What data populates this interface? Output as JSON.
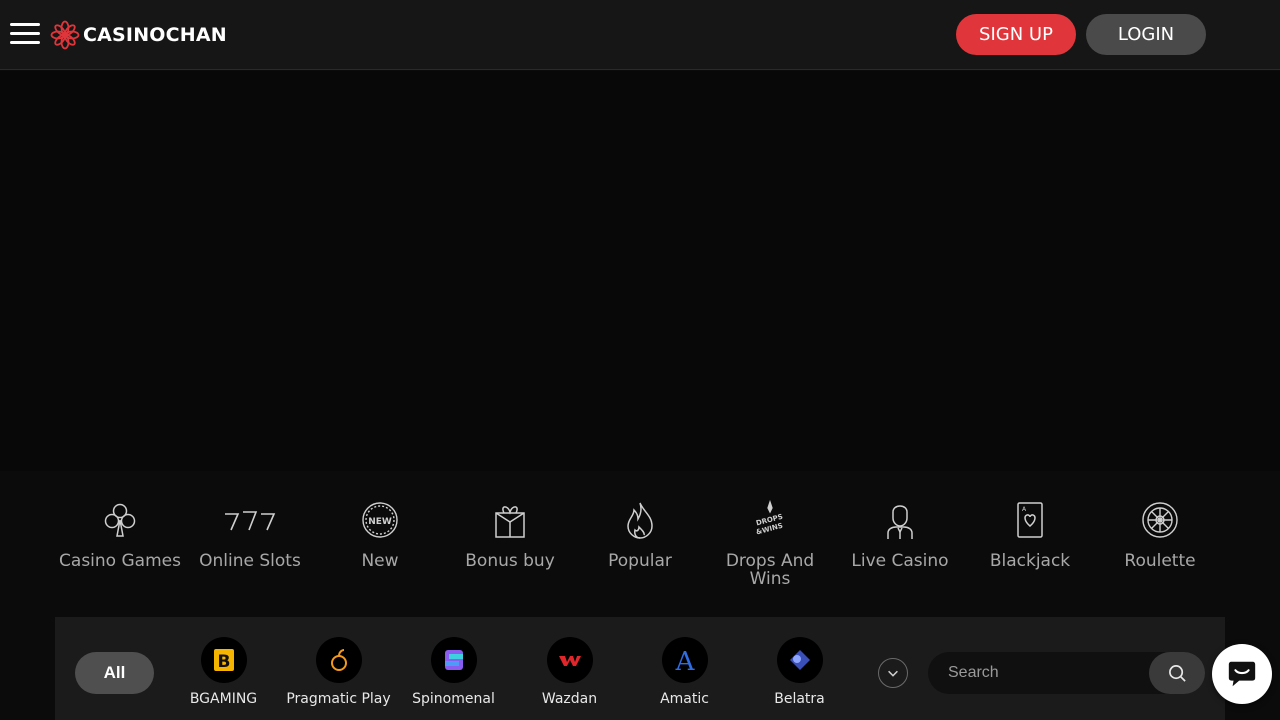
{
  "header": {
    "logo_text": "CASINOCHAN",
    "signup_label": "SIGN UP",
    "login_label": "LOGIN"
  },
  "categories": [
    {
      "label": "Casino Games",
      "icon": "club-icon"
    },
    {
      "label": "Online Slots",
      "icon": "triple-seven-icon"
    },
    {
      "label": "New",
      "icon": "new-badge-icon"
    },
    {
      "label": "Bonus buy",
      "icon": "gift-box-icon"
    },
    {
      "label": "Popular",
      "icon": "flame-icon"
    },
    {
      "label": "Drops And Wins",
      "icon": "drops-wins-icon"
    },
    {
      "label": "Live Casino",
      "icon": "dealer-icon"
    },
    {
      "label": "Blackjack",
      "icon": "playing-card-icon"
    },
    {
      "label": "Roulette",
      "icon": "roulette-icon"
    }
  ],
  "providers": {
    "all_label": "All",
    "items": [
      {
        "name": "BGAMING",
        "icon": "bgaming-logo-icon"
      },
      {
        "name": "Pragmatic Play",
        "icon": "pragmatic-logo-icon"
      },
      {
        "name": "Spinomenal",
        "icon": "spinomenal-logo-icon"
      },
      {
        "name": "Wazdan",
        "icon": "wazdan-logo-icon"
      },
      {
        "name": "Amatic",
        "icon": "amatic-logo-icon"
      },
      {
        "name": "Belatra",
        "icon": "belatra-logo-icon"
      }
    ],
    "search_placeholder": "Search"
  },
  "colors": {
    "accent": "#e0363b",
    "secondary_button": "#4a4a4a",
    "background": "#0b0b0b"
  }
}
